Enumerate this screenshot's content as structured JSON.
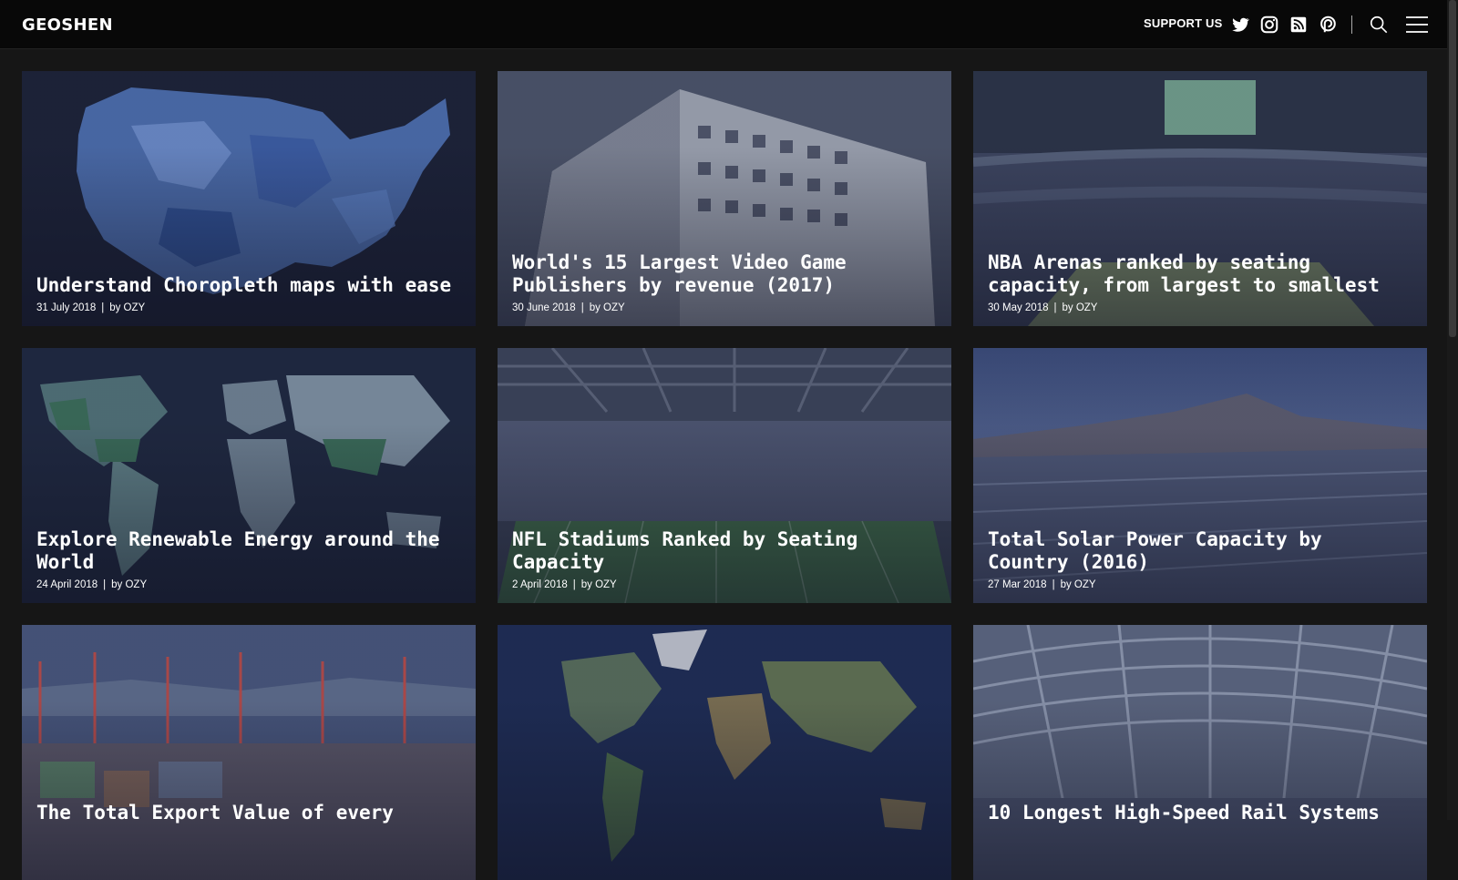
{
  "header": {
    "logo": "GEOSHEN",
    "support_label": "SUPPORT US",
    "icons": [
      "twitter-icon",
      "instagram-icon",
      "rss-icon",
      "patreon-icon",
      "search-icon",
      "menu-icon"
    ]
  },
  "meta_sep": "|",
  "cards": [
    {
      "title": "Understand Choropleth maps with ease",
      "date": "31 July 2018",
      "author": "by OZY"
    },
    {
      "title": "World's 15 Largest Video Game Publishers by revenue (2017)",
      "date": "30 June 2018",
      "author": "by OZY"
    },
    {
      "title": "NBA Arenas ranked by seating capacity, from largest to smallest",
      "date": "30 May 2018",
      "author": "by OZY"
    },
    {
      "title": "Explore Renewable Energy around the World",
      "date": "24 April 2018",
      "author": "by OZY"
    },
    {
      "title": "NFL Stadiums Ranked by Seating Capacity",
      "date": "2 April 2018",
      "author": "by OZY"
    },
    {
      "title": "Total Solar Power Capacity by Country (2016)",
      "date": "27 Mar 2018",
      "author": "by OZY"
    },
    {
      "title": "The Total Export Value of every",
      "date": "",
      "author": ""
    },
    {
      "title": "",
      "date": "",
      "author": ""
    },
    {
      "title": "10 Longest High-Speed Rail Systems",
      "date": "",
      "author": ""
    }
  ],
  "colors": {
    "background": "#161616",
    "header": "#080808",
    "text": "#ffffff"
  }
}
